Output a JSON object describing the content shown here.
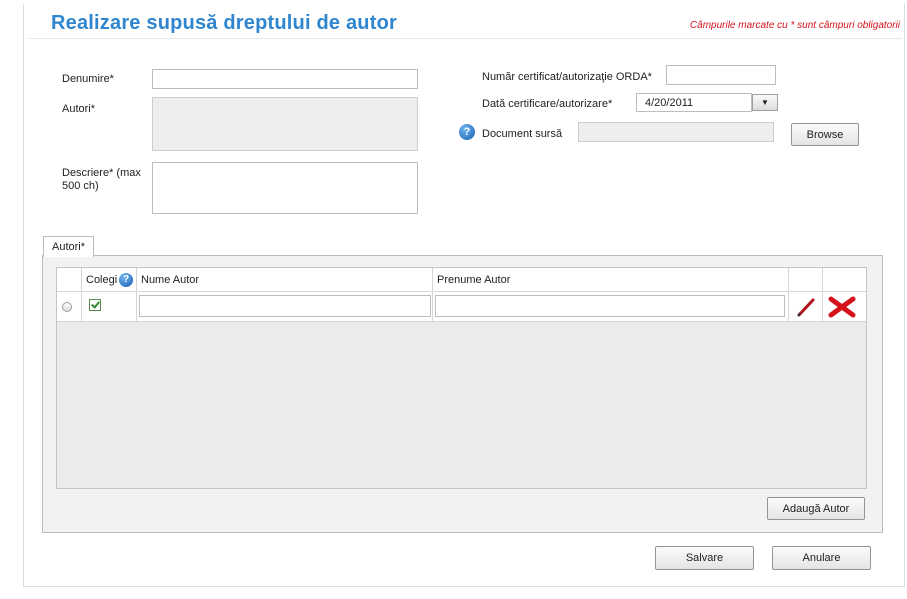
{
  "page": {
    "title": "Realizare supusă dreptului de autor",
    "required_note": "Câmpurile marcate cu * sunt câmpuri obligatorii"
  },
  "form": {
    "denumire": {
      "label": "Denumire*",
      "value": ""
    },
    "autori": {
      "label": "Autori*",
      "value": ""
    },
    "descriere": {
      "label": "Descriere* (max 500 ch)",
      "value": ""
    },
    "numar_certificat": {
      "label": "Număr certificat/autorizaţie ORDA*",
      "value": ""
    },
    "data_certificare": {
      "label": "Dată certificare/autorizare*",
      "value": "4/20/2011"
    },
    "document_sursa": {
      "label": "Document sursă",
      "value": "",
      "browse_label": "Browse"
    }
  },
  "tabs": [
    {
      "label": "Autori*"
    }
  ],
  "authors_grid": {
    "columns": {
      "colegi": "Colegi",
      "nume": "Nume Autor",
      "prenume": "Prenume Autor"
    },
    "rows": [
      {
        "selected": false,
        "colegi": true,
        "nume": "",
        "prenume": ""
      }
    ],
    "add_button": "Adaugă Autor"
  },
  "actions": {
    "save": "Salvare",
    "cancel": "Anulare"
  },
  "icons": {
    "help": "question-circle-icon",
    "edit": "pencil-icon",
    "delete": "red-x-icon",
    "date_picker": "dropdown-arrow-icon"
  },
  "colors": {
    "title": "#2f86cf",
    "required_note": "#d4131b",
    "delete": "#d4131b"
  }
}
